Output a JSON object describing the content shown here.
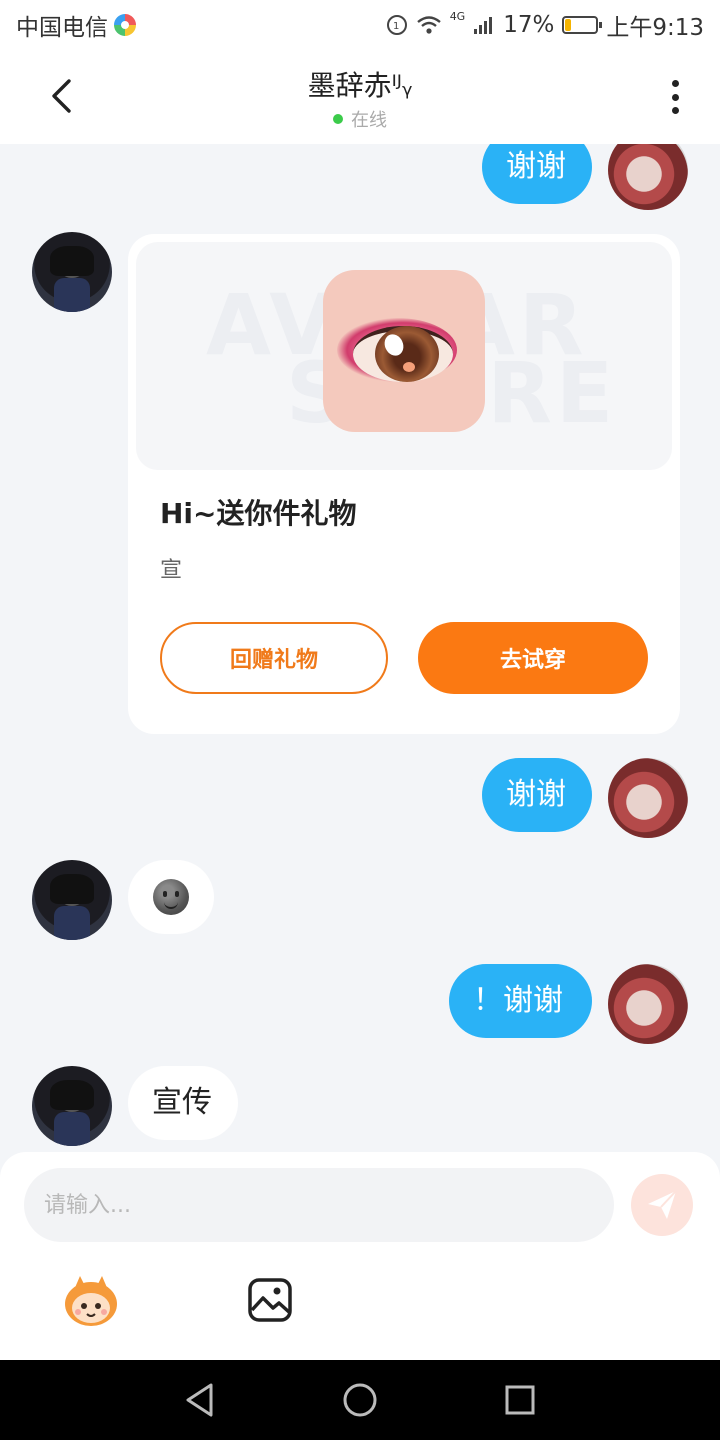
{
  "status_bar": {
    "carrier": "中国电信",
    "network": "4G",
    "battery": "17%",
    "battery_level": 0.17,
    "time": "上午9:13"
  },
  "header": {
    "contact_name": "墨辞赤ᴵᴶᵧ",
    "status": "在线",
    "status_color": "#3bcb4a"
  },
  "messages": [
    {
      "side": "me",
      "text": "谢谢"
    },
    {
      "side": "other",
      "type": "gift",
      "watermark_line1": "AVATAR",
      "watermark_line2": "STORE",
      "title": "Hi~送你件礼物",
      "subtitle": "宣",
      "return_gift_label": "回赠礼物",
      "try_on_label": "去试穿"
    },
    {
      "side": "me",
      "text": "谢谢"
    },
    {
      "side": "other",
      "type": "emoji",
      "icon": "smiley-face-icon"
    },
    {
      "side": "me",
      "text": "！谢谢"
    },
    {
      "side": "other",
      "text": "宣传"
    }
  ],
  "composer": {
    "placeholder": "请输入...",
    "icons": [
      "send-icon",
      "mascot-sticker-icon",
      "image-icon"
    ]
  },
  "colors": {
    "my_bubble": "#2ab2f6",
    "accent_orange": "#fb7912",
    "chat_background": "#f3f5f8"
  }
}
